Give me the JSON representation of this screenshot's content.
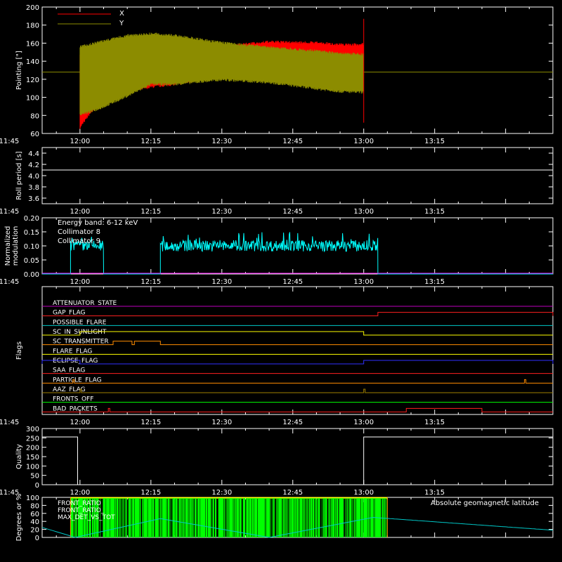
{
  "time_ticks": [
    "11:45",
    "12:00",
    "12:15",
    "12:30",
    "12:45",
    "13:00",
    "13:15"
  ],
  "colors": {
    "background": "#000000",
    "axis": "#ffffff",
    "red": "#ff0000",
    "olive": "#8c8c00",
    "cyan": "#00ffff",
    "magenta": "#ff00ff",
    "orange": "#ff8c00",
    "blue": "#0000ff",
    "yellow": "#ffff00",
    "green": "#00ff00",
    "purple": "#c000c0"
  },
  "chart_data": [
    {
      "type": "area",
      "id": "pointing",
      "ylabel": "Pointing [\"]",
      "ylim": [
        60,
        200
      ],
      "yticks": [
        60,
        80,
        100,
        120,
        140,
        160,
        180,
        200
      ],
      "xlim_minutes": [
        -8,
        100
      ],
      "series": [
        {
          "name": "X",
          "color": "#ff0000",
          "envelope_x_minutes": [
            0,
            2,
            5,
            10,
            15,
            20,
            30,
            40,
            50,
            55,
            60
          ],
          "envelope_min": [
            65,
            80,
            95,
            105,
            110,
            113,
            122,
            126,
            123,
            120,
            119
          ],
          "envelope_max": [
            150,
            148,
            146,
            143,
            140,
            145,
            158,
            163,
            162,
            160,
            160
          ]
        },
        {
          "name": "Y",
          "color": "#8c8c00",
          "envelope_x_minutes": [
            0,
            2,
            5,
            10,
            15,
            20,
            30,
            40,
            50,
            55,
            60
          ],
          "envelope_min": [
            80,
            82,
            88,
            100,
            113,
            113,
            118,
            115,
            108,
            105,
            104
          ],
          "envelope_max": [
            158,
            160,
            164,
            170,
            172,
            170,
            162,
            157,
            153,
            150,
            149
          ]
        },
        {
          "name": "baseline",
          "color": "#8c8c00",
          "values_y": [
            128
          ]
        }
      ]
    },
    {
      "type": "line",
      "id": "roll_period",
      "ylabel": "Roll period [s]",
      "ylim": [
        3.5,
        4.5
      ],
      "yticks": [
        3.6,
        3.8,
        4.0,
        4.2,
        4.4
      ],
      "xlim_minutes": [
        -8,
        100
      ],
      "series": [
        {
          "name": "",
          "color": "#ffffff",
          "x_minutes": [
            -8,
            100
          ],
          "values": [
            4.1,
            4.1
          ]
        }
      ]
    },
    {
      "type": "line",
      "id": "modulation",
      "ylabel": "Normalized modulation",
      "ylim": [
        0,
        0.2
      ],
      "yticks": [
        0.0,
        0.05,
        0.1,
        0.15,
        0.2
      ],
      "xlim_minutes": [
        -8,
        100
      ],
      "annotation": "Energy band: 6-12 keV",
      "series": [
        {
          "name": "Collimator 8",
          "color": "#00ffff",
          "active_intervals_minutes": [
            [
              -2,
              5
            ],
            [
              17,
              63
            ]
          ],
          "mean": 0.1,
          "spread": 0.02
        },
        {
          "name": "Collimator 9",
          "color": "#ff00ff",
          "values": [
            0
          ]
        }
      ]
    },
    {
      "type": "line",
      "id": "flags",
      "ylabel": "Flags",
      "xlim_minutes": [
        -8,
        100
      ],
      "series": [
        {
          "name": "ATTENUATOR_STATE",
          "color": "#c000c0",
          "steps": []
        },
        {
          "name": "GAP_FLAG",
          "color": "#ff2020",
          "steps": [
            [
              63,
              100
            ]
          ]
        },
        {
          "name": "POSSIBLE_FLARE",
          "color": "#00c8c8",
          "steps": []
        },
        {
          "name": "SC_IN_SUNLIGHT",
          "color": "#ffff00",
          "steps": [
            [
              0,
              60
            ]
          ]
        },
        {
          "name": "SC_TRANSMITTER",
          "color": "#ff8c00",
          "steps": [
            [
              7,
              11
            ],
            [
              11.5,
              17
            ]
          ]
        },
        {
          "name": "FLARE_FLAG",
          "color": "#ffff00",
          "steps": []
        },
        {
          "name": "ECLIPSE_FLAG",
          "color": "#3030ff",
          "steps": [
            [
              -8,
              0
            ],
            [
              60,
              100
            ]
          ]
        },
        {
          "name": "SAA_FLAG",
          "color": "#ff2020",
          "steps": []
        },
        {
          "name": "PARTICLE_FLAG",
          "color": "#ff8c00",
          "spikes": [
            -1.5,
            94
          ]
        },
        {
          "name": "AAZ_FLAG",
          "color": "#a08000",
          "spikes": [
            0,
            60
          ]
        },
        {
          "name": "FRONTS_OFF",
          "color": "#00ff00",
          "steps": []
        },
        {
          "name": "BAD_PACKETS",
          "color": "#ff2020",
          "steps": [
            [
              69,
              85
            ]
          ],
          "spikes": [
            6
          ]
        }
      ]
    },
    {
      "type": "line",
      "id": "quality",
      "ylabel": "Quality",
      "ylim": [
        0,
        300
      ],
      "yticks": [
        0,
        50,
        100,
        150,
        200,
        250,
        300
      ],
      "xlim_minutes": [
        -8,
        100
      ],
      "series": [
        {
          "name": "",
          "color": "#ffffff",
          "x_minutes": [
            -8,
            -0.5,
            -0.5,
            60,
            60,
            100
          ],
          "values": [
            255,
            255,
            0,
            0,
            255,
            255
          ]
        }
      ]
    },
    {
      "type": "bar",
      "id": "degrees",
      "ylabel": "Degrees or %",
      "ylim": [
        0,
        100
      ],
      "yticks": [
        0,
        20,
        40,
        60,
        80,
        100
      ],
      "xlim_minutes": [
        -8,
        100
      ],
      "annotation": "Absolute geomagnetic latitude",
      "series": [
        {
          "name": "FRONT_RATIO",
          "color": "#ffff00"
        },
        {
          "name": "FRONT_RATIO_",
          "color": "#00ff00",
          "active_interval_minutes": [
            -2,
            65
          ]
        },
        {
          "name": "MAX_DET_VS_TOT",
          "color": "#ff8c00"
        },
        {
          "name": "Absolute geomagnetic latitude",
          "color": "#00c8c8",
          "x_minutes": [
            -8,
            -1,
            17,
            40,
            62,
            100
          ],
          "values": [
            25,
            0,
            47,
            0,
            50,
            18
          ]
        }
      ]
    }
  ]
}
